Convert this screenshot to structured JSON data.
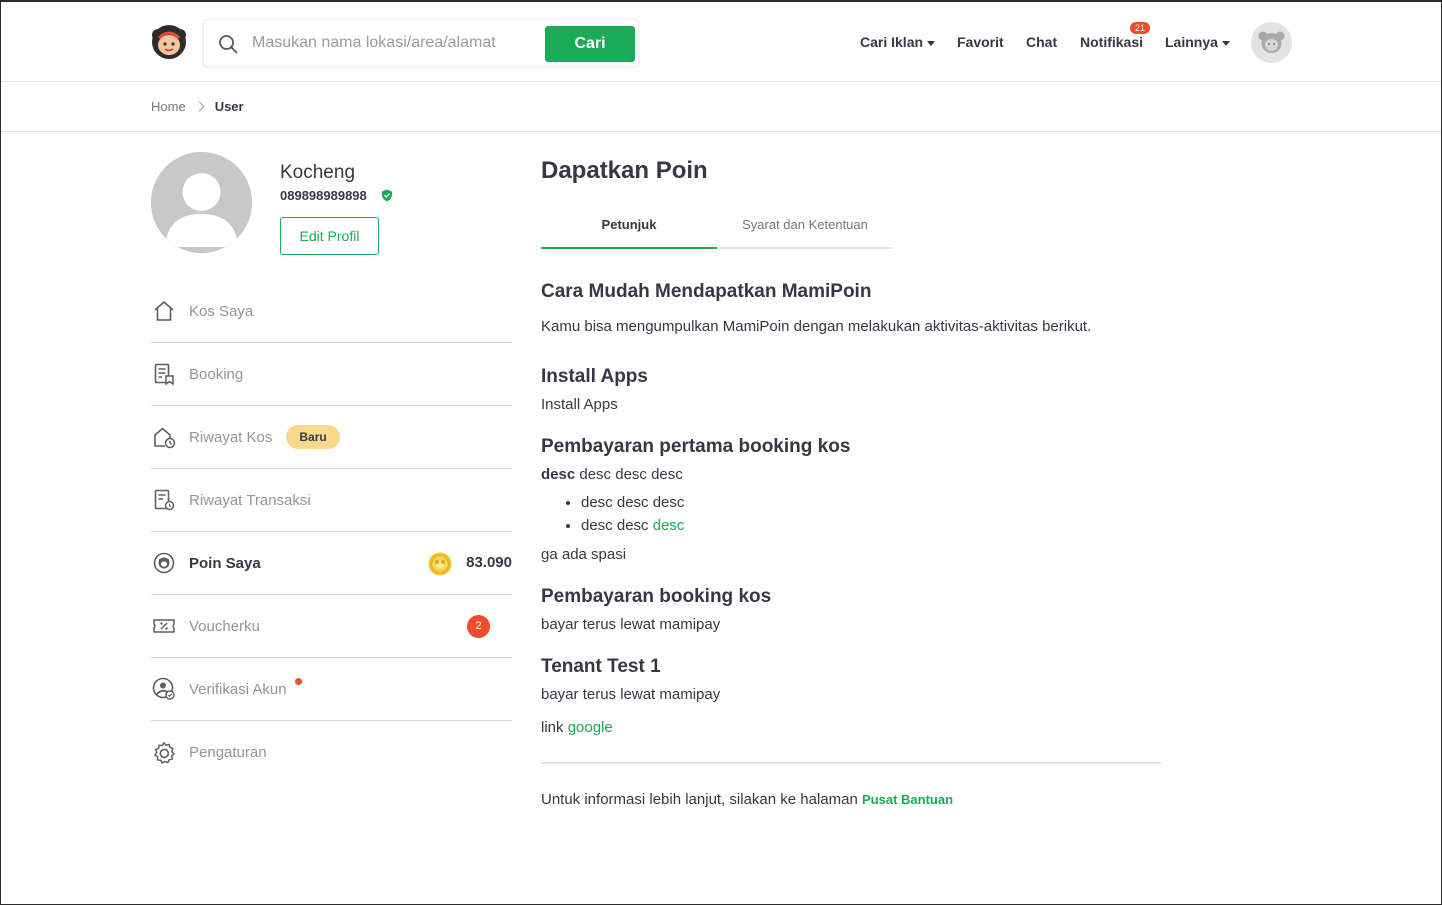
{
  "header": {
    "search_placeholder": "Masukan nama lokasi/area/alamat",
    "search_button": "Cari",
    "nav": {
      "cari_iklan": "Cari Iklan",
      "favorit": "Favorit",
      "chat": "Chat",
      "notifikasi": "Notifikasi",
      "notif_count": "21",
      "lainnya": "Lainnya"
    }
  },
  "breadcrumb": {
    "home": "Home",
    "current": "User"
  },
  "profile": {
    "name": "Kocheng",
    "phone": "089898989898",
    "edit_button": "Edit Profil"
  },
  "menu": {
    "kos_saya": "Kos Saya",
    "booking": "Booking",
    "riwayat_kos": "Riwayat Kos",
    "badge_baru": "Baru",
    "riwayat_transaksi": "Riwayat Transaksi",
    "poin_saya": "Poin Saya",
    "poin_value": "83.090",
    "voucherku": "Voucherku",
    "voucher_count": "2",
    "verifikasi_akun": "Verifikasi Akun",
    "pengaturan": "Pengaturan"
  },
  "main": {
    "title": "Dapatkan Poin",
    "tabs": [
      "Petunjuk",
      "Syarat dan Ketentuan"
    ],
    "heading": "Cara Mudah Mendapatkan MamiPoin",
    "intro": "Kamu bisa mengumpulkan MamiPoin dengan melakukan aktivitas-aktivitas berikut.",
    "sections": [
      {
        "title": "Install Apps",
        "desc": "Install Apps"
      },
      {
        "title": "Pembayaran pertama booking kos",
        "desc_bold": "desc",
        "desc_rest": " desc desc desc",
        "bullets": [
          "desc desc desc",
          "desc desc "
        ],
        "bullet_link": "desc",
        "after": "ga ada spasi"
      },
      {
        "title": "Pembayaran booking kos",
        "desc": "bayar terus lewat mamipay"
      },
      {
        "title": "Tenant Test 1",
        "desc": "bayar terus lewat mamipay",
        "link_prefix": "link ",
        "link": "google"
      }
    ],
    "footer_text": "Untuk informasi lebih lanjut, silakan ke halaman ",
    "footer_link": "Pusat Bantuan"
  },
  "colors": {
    "accent": "#1baa56",
    "badge_red": "#ee4c2b",
    "badge_yellow": "#f9d98d"
  }
}
